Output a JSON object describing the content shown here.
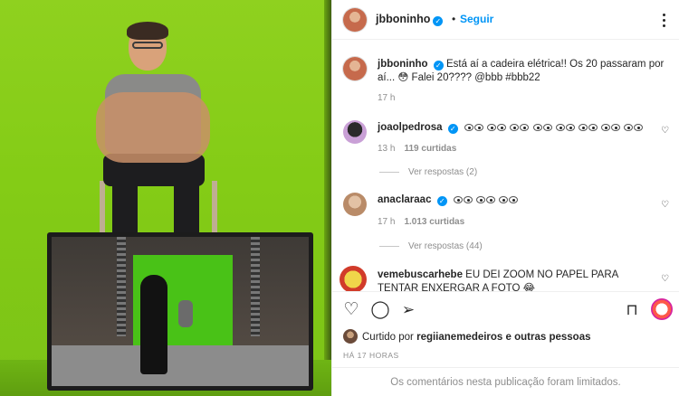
{
  "post": {
    "author": "jbboninho",
    "separator": "•",
    "follow_label": "Seguir"
  },
  "caption": {
    "username": "jbboninho",
    "text": "Está aí a cadeira elétrica!! Os 20 passaram por aí... 😳 Falei 20???? @bbb #bbb22",
    "time": "17 h"
  },
  "comments": [
    {
      "username": "joaolpedrosa",
      "verified": true,
      "text_emoji": "eyes",
      "eye_count": 8,
      "time": "13 h",
      "likes": "119 curtidas",
      "replies": "Ver respostas (2)"
    },
    {
      "username": "anaclaraac",
      "verified": true,
      "text_emoji": "eyes",
      "eye_count": 3,
      "time": "17 h",
      "likes": "1.013 curtidas",
      "replies": "Ver respostas (44)"
    },
    {
      "username": "vemebuscarhebe",
      "verified": false,
      "text": "EU DEI ZOOM NO PAPEL PARA TENTAR ENXERGAR A FOTO 😂"
    }
  ],
  "actions": {
    "like_icon": "heart-icon",
    "comment_icon": "comment-icon",
    "share_icon": "share-icon",
    "save_icon": "bookmark-icon"
  },
  "likes_summary": {
    "prefix": "Curtido por",
    "user": "regiianemedeiros",
    "suffix": "e outras pessoas"
  },
  "time_ago": "HÁ 17 HORAS",
  "comments_limited": "Os comentários nesta publicação foram limitados.",
  "colors": {
    "accent": "#0095f6",
    "muted": "#8e8e8e",
    "text": "#262626",
    "greenscreen": "#84cc16"
  }
}
